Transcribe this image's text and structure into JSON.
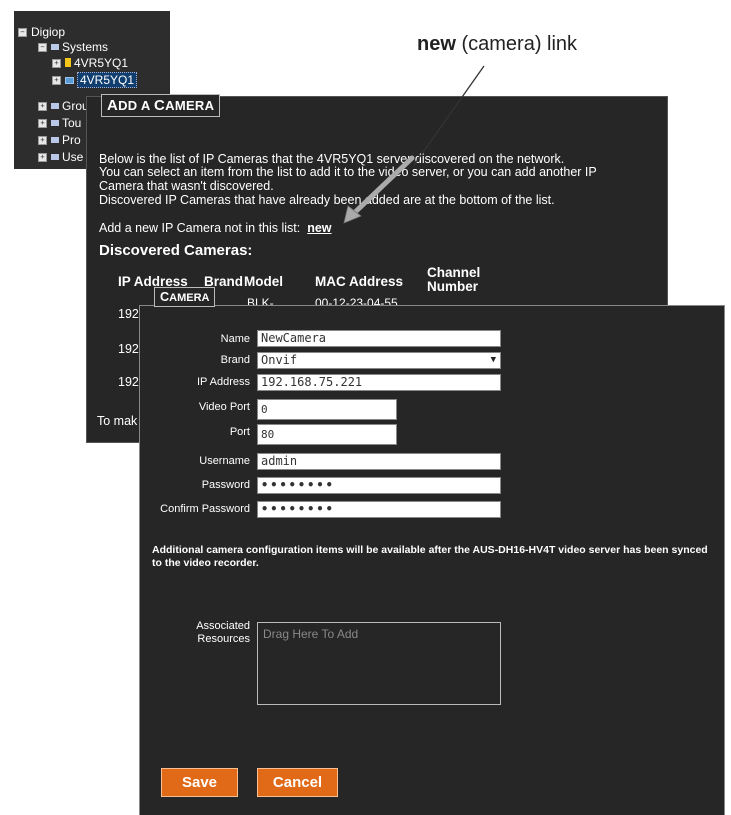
{
  "tree": {
    "root": "Digiop",
    "systems": "Systems",
    "server_1": "4VR5YQ1",
    "server_2": "4VR5YQ1",
    "item_groups": "Grou",
    "item_tours": "Tou",
    "item_profiles": "Pro",
    "item_users": "Use"
  },
  "add_camera": {
    "title_first": "A",
    "title_rest": "DD A ",
    "title_first2": "C",
    "title_rest2": "AMERA",
    "intro": "Below is the list of IP Cameras that the 4VR5YQ1 server discovered on the network.",
    "intro2": "You can select an item from the list to add it to the video server, or you can add another IP",
    "intro3": "Camera that wasn't discovered.",
    "intro4": "Discovered IP Cameras that have already been added are at the bottom of the list.",
    "add_new_label": "Add a new IP Camera not in this list:",
    "new_link": "new",
    "discovered_header": "Discovered Cameras:",
    "columns": {
      "ip": "IP Address",
      "brand": "Brand",
      "model": "Model",
      "mac": "MAC Address",
      "channel_1": "Channel",
      "channel_2": "Number"
    },
    "row_1_ip": "192",
    "row_1_model": "BLK-",
    "row_1_mac": "00-12-23-04-55",
    "row_2_ip": "192",
    "row_3_ip": "192",
    "footer": "To mak"
  },
  "camera_form": {
    "title_first": "C",
    "title_rest": "AMERA",
    "name_label": "Name",
    "name_value": "NewCamera",
    "brand_label": "Brand",
    "brand_value": "Onvif",
    "ip_label": "IP Address",
    "ip_value": "192.168.75.221",
    "video_port_label": "Video Port",
    "video_port_value": "0",
    "port_label": "Port",
    "port_value": "80",
    "username_label": "Username",
    "username_value": "admin",
    "password_label": "Password",
    "password_value": "••••••••",
    "confirm_label": "Confirm Password",
    "confirm_value": "••••••••",
    "note": "Additional camera configuration items will be available after the AUS-DH16-HV4T video server has been synced to the video recorder.",
    "resources_label_1": "Associated",
    "resources_label_2": "Resources",
    "resources_placeholder": "Drag Here To Add",
    "save_label": "Save",
    "cancel_label": "Cancel"
  },
  "annotation": {
    "bold": "new",
    "rest": " (camera) link"
  },
  "colors": {
    "panel_bg": "#262626",
    "button_orange": "#e06a18"
  }
}
